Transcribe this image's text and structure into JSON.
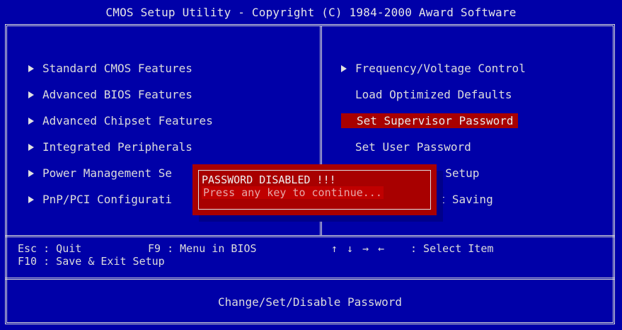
{
  "title": "CMOS Setup Utility - Copyright (C) 1984-2000 Award Software",
  "left_menu": [
    {
      "label": "Standard CMOS Features",
      "arrow": true
    },
    {
      "label": "Advanced BIOS Features",
      "arrow": true
    },
    {
      "label": "Advanced Chipset Features",
      "arrow": true
    },
    {
      "label": "Integrated Peripherals",
      "arrow": true
    },
    {
      "label": "Power Management Se",
      "arrow": true
    },
    {
      "label": "PnP/PCI Configurati",
      "arrow": true
    }
  ],
  "right_menu": [
    {
      "label": "Frequency/Voltage Control",
      "arrow": true
    },
    {
      "label": "Load Optimized Defaults",
      "arrow": false
    },
    {
      "label": "Set Supervisor Password",
      "arrow": false,
      "selected": true
    },
    {
      "label": "Set User Password",
      "arrow": false
    },
    {
      "label": "t Setup",
      "arrow": false
    },
    {
      "label": "ut Saving",
      "arrow": false
    }
  ],
  "dialog": {
    "line1": "PASSWORD DISABLED !!!",
    "line2": "Press any key to continue..."
  },
  "keys": {
    "esc": "Esc : Quit",
    "f9": "F9 : Menu in BIOS",
    "f10": "F10 : Save & Exit Setup",
    "arrows_glyph": "↑ ↓ → ←",
    "select": ": Select Item"
  },
  "status_help": "Change/Set/Disable Password",
  "colors": {
    "background": "#0000a8",
    "highlight": "#a80000",
    "text": "#d8d8d8"
  }
}
